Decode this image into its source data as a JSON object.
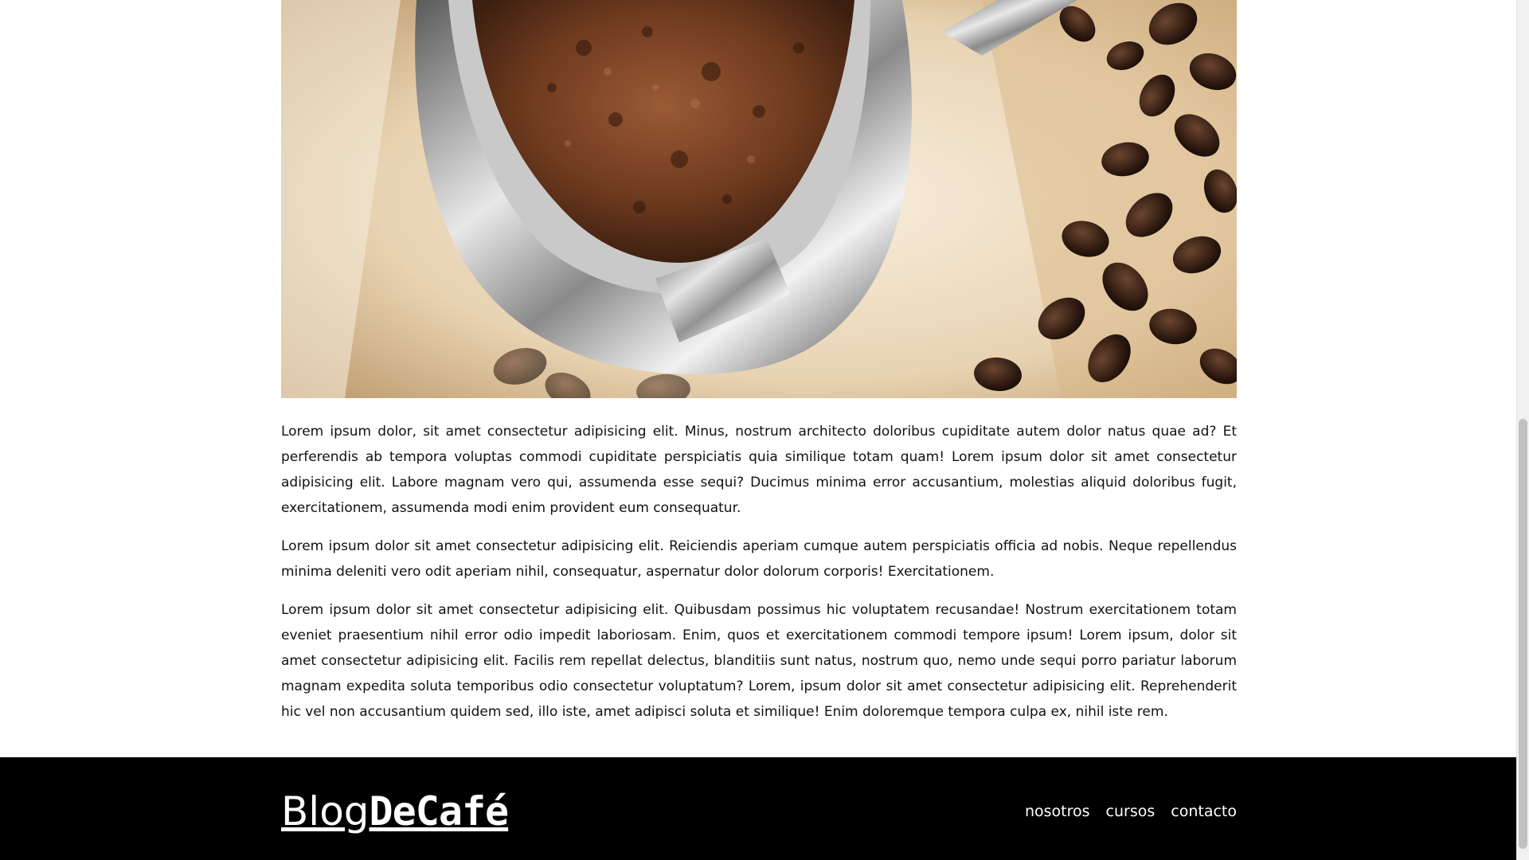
{
  "hero": {
    "image": "coffee-portafilter-with-ground-coffee-and-beans"
  },
  "article": {
    "paragraphs": [
      "Lorem ipsum dolor, sit amet consectetur adipisicing elit. Minus, nostrum architecto doloribus cupiditate autem dolor natus quae ad? Et perferendis ab tempora voluptas commodi cupiditate perspiciatis quia similique totam quam! Lorem ipsum dolor sit amet consectetur adipisicing elit. Labore magnam vero qui, assumenda esse sequi? Ducimus minima error accusantium, molestias aliquid doloribus fugit, exercitationem, assumenda modi enim provident eum consequatur.",
      "Lorem ipsum dolor sit amet consectetur adipisicing elit. Reiciendis aperiam cumque autem perspiciatis officia ad nobis. Neque repellendus minima deleniti vero odit aperiam nihil, consequatur, aspernatur dolor dolorum corporis! Exercitationem.",
      "Lorem ipsum dolor sit amet consectetur adipisicing elit. Quibusdam possimus hic voluptatem recusandae! Nostrum exercitationem totam eveniet praesentium nihil error odio impedit laboriosam. Enim, quos et exercitationem commodi tempore ipsum! Lorem ipsum, dolor sit amet consectetur adipisicing elit. Facilis rem repellat delectus, blanditiis sunt natus, nostrum quo, nemo unde sequi porro pariatur laborum magnam expedita soluta temporibus odio consectetur voluptatum? Lorem, ipsum dolor sit amet consectetur adipisicing elit. Reprehenderit hic vel non accusantium quidem sed, illo iste, amet adipisci soluta et similique! Enim doloremque tempora culpa ex, nihil iste rem."
    ]
  },
  "footer": {
    "logo_light": "Blog",
    "logo_bold": "DeCafé",
    "nav": [
      "nosotros",
      "cursos",
      "contacto"
    ]
  },
  "colors": {
    "footer_bg": "#000000",
    "footer_text": "#ffffff",
    "scrollbar_thumb": "#c1c1c1"
  }
}
